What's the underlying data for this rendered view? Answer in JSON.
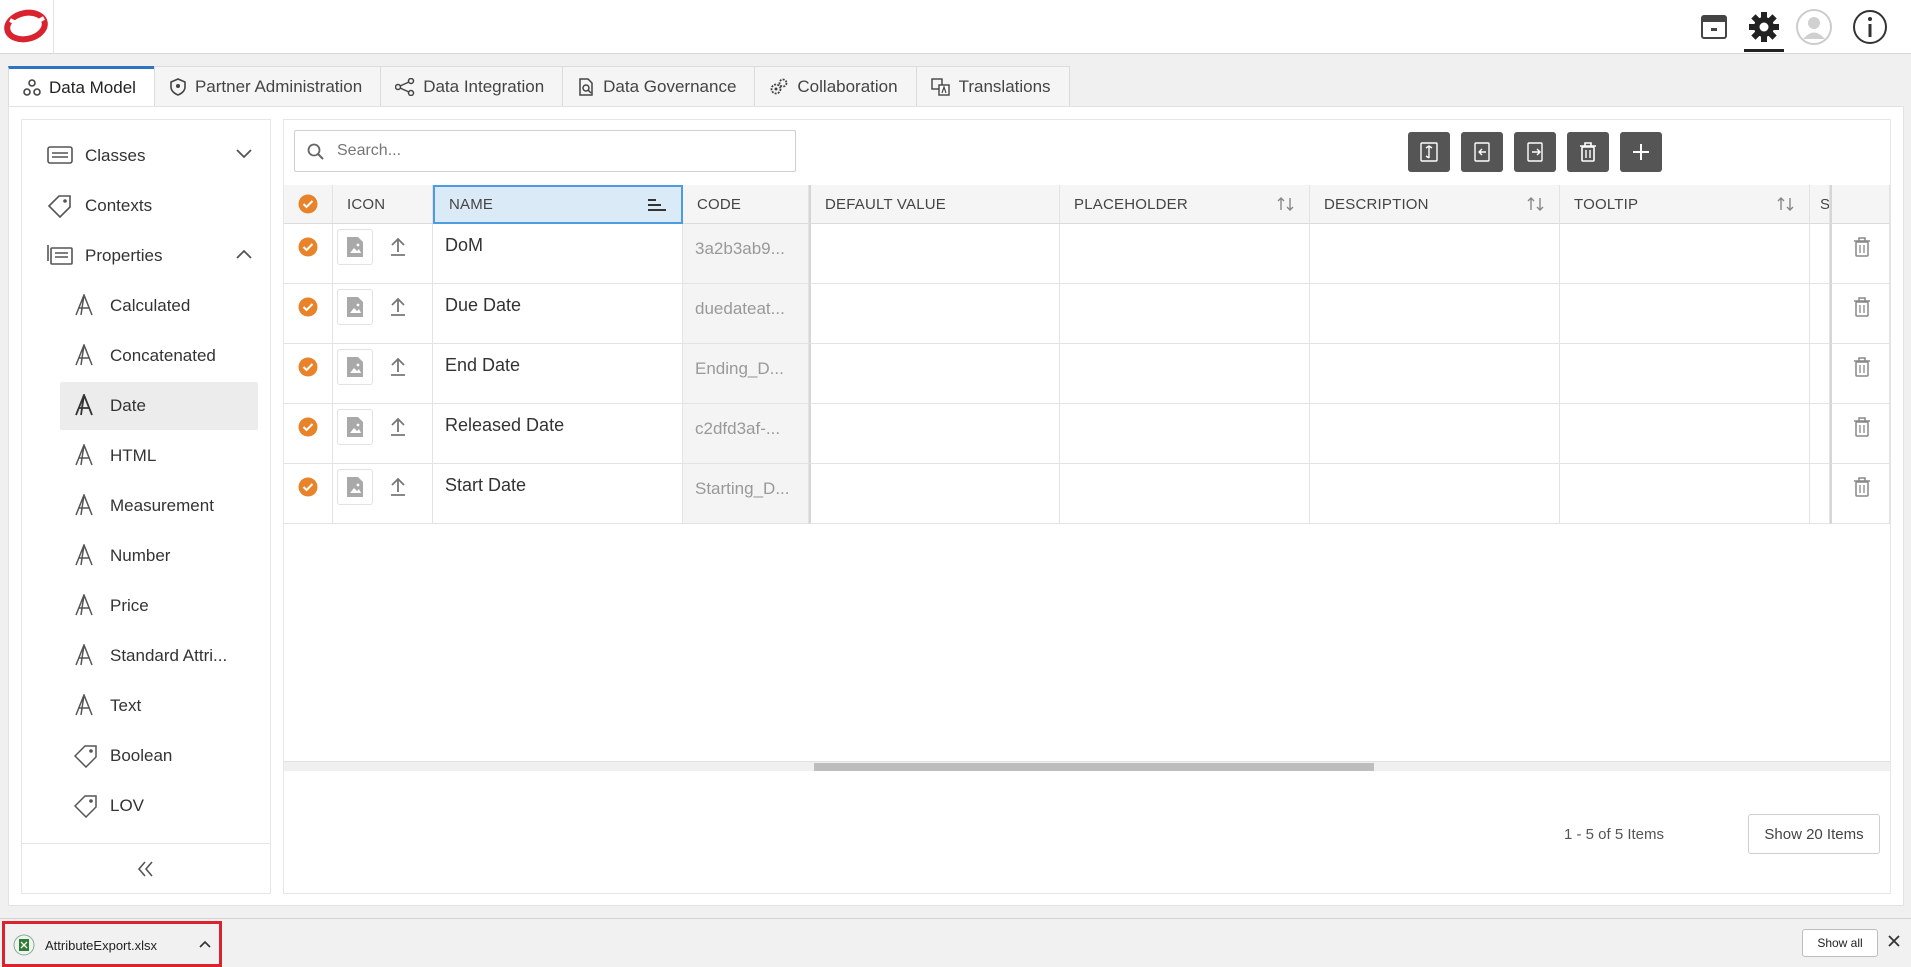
{
  "tabs": [
    {
      "label": "Data Model",
      "icon": "data-model-icon",
      "active": true
    },
    {
      "label": "Partner Administration",
      "icon": "shield-icon",
      "active": false
    },
    {
      "label": "Data Integration",
      "icon": "integration-icon",
      "active": false
    },
    {
      "label": "Data Governance",
      "icon": "governance-icon",
      "active": false
    },
    {
      "label": "Collaboration",
      "icon": "gears-icon",
      "active": false
    },
    {
      "label": "Translations",
      "icon": "translate-icon",
      "active": false
    }
  ],
  "sidebar": {
    "classes": "Classes",
    "contexts": "Contexts",
    "properties": "Properties",
    "property_types": [
      "Calculated",
      "Concatenated",
      "Date",
      "HTML",
      "Measurement",
      "Number",
      "Price",
      "Standard Attri...",
      "Text",
      "Boolean",
      "LOV"
    ],
    "selected": "Date"
  },
  "search": {
    "placeholder": "Search..."
  },
  "grid": {
    "headers": {
      "icon": "ICON",
      "name": "NAME",
      "code": "CODE",
      "default_value": "DEFAULT VALUE",
      "placeholder": "PLACEHOLDER",
      "description": "DESCRIPTION",
      "tooltip": "TOOLTIP",
      "overflow": "S"
    },
    "rows": [
      {
        "name": "DoM",
        "code": "3a2b3ab9..."
      },
      {
        "name": "Due Date",
        "code": "duedateat..."
      },
      {
        "name": "End Date",
        "code": "Ending_D..."
      },
      {
        "name": "Released Date",
        "code": "c2dfd3af-..."
      },
      {
        "name": "Start Date",
        "code": "Starting_D..."
      }
    ]
  },
  "pager": {
    "summary": "1 - 5 of 5 Items",
    "show_label": "Show 20 Items"
  },
  "download": {
    "filename": "AttributeExport.xlsx",
    "show_all": "Show all"
  },
  "colors": {
    "accent_orange": "#e8832a",
    "tab_accent": "#2f74c4",
    "highlight_red": "#d9232e"
  }
}
